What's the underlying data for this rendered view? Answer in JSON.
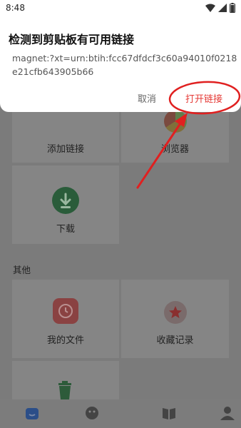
{
  "status": {
    "time": "8:48"
  },
  "dialog": {
    "title": "检测到剪贴板有可用链接",
    "link": "magnet:?xt=urn:btih:fcc67dfdcf3c60a94010f0218e21cfb643905b66",
    "cancel_label": "取消",
    "open_label": "打开链接"
  },
  "tiles": {
    "add_link": "添加链接",
    "browser": "浏览器",
    "download": "下载"
  },
  "other_section": {
    "title": "其他",
    "my_files": "我的文件",
    "favorites": "收藏记录"
  },
  "colors": {
    "accent": "#e53935",
    "annotation": "#e02020"
  }
}
